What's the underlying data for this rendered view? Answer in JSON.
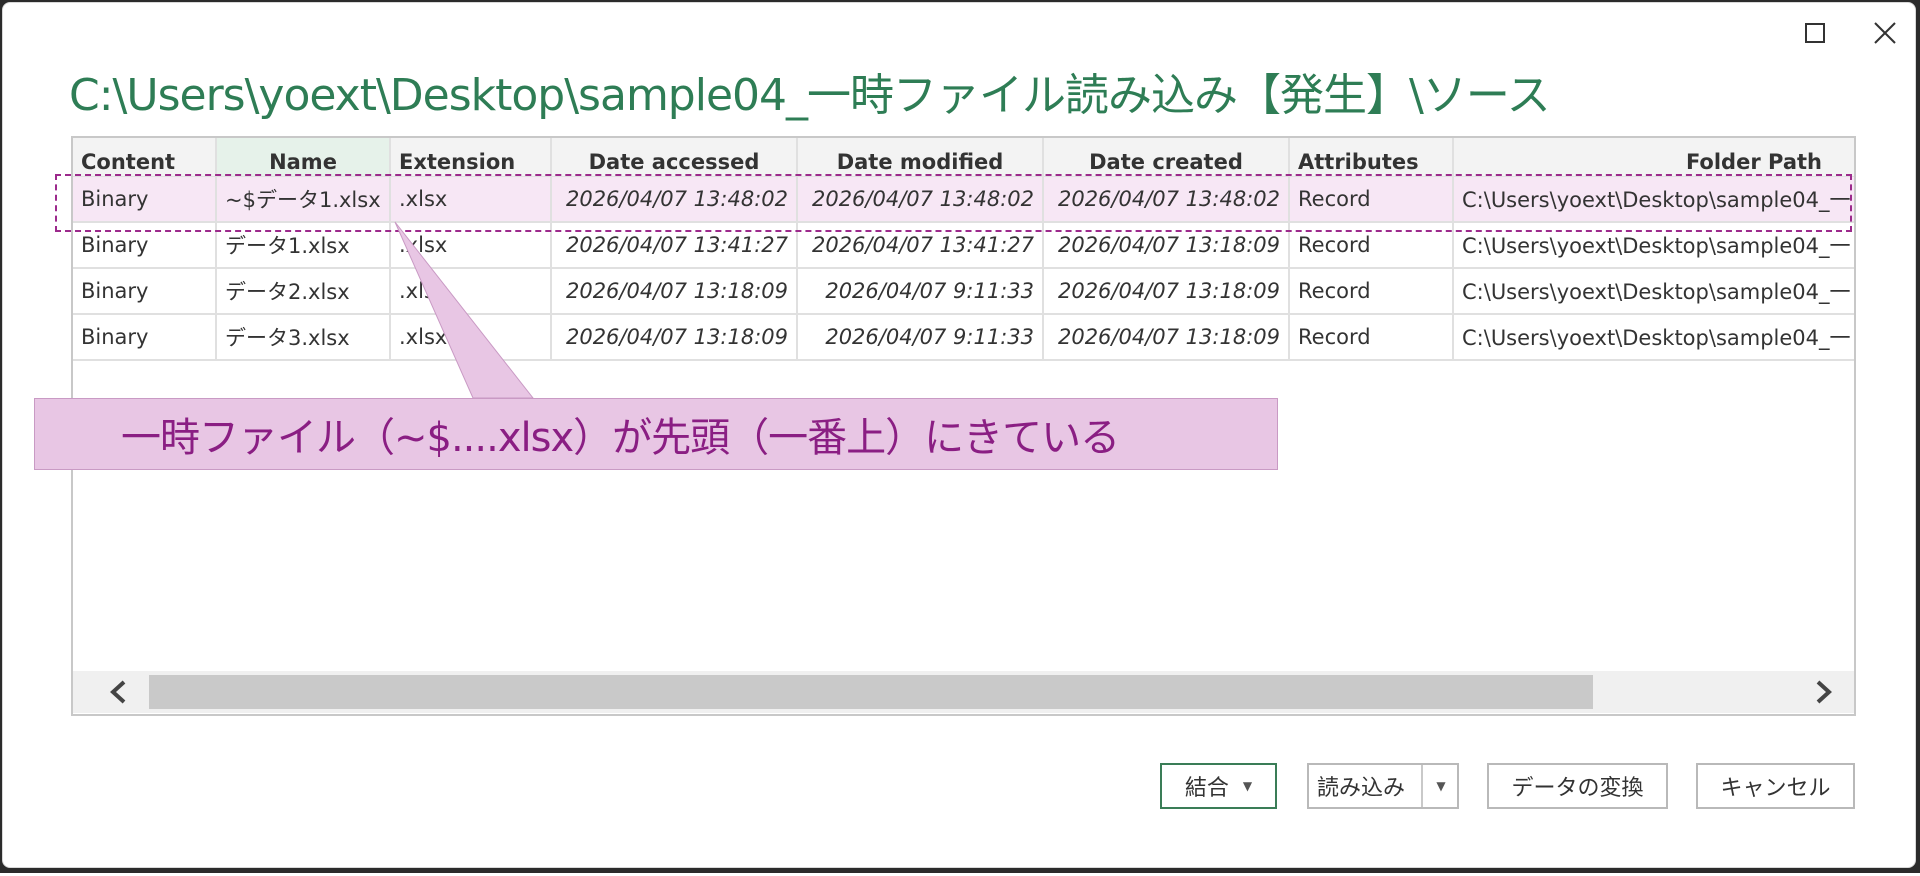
{
  "window": {
    "title": "C:\\Users\\yoext\\Desktop\\sample04_一時ファイル読み込み【発生】\\ソース"
  },
  "table": {
    "columns": [
      "Content",
      "Name",
      "Extension",
      "Date accessed",
      "Date modified",
      "Date created",
      "Attributes",
      "Folder Path"
    ],
    "rows": [
      [
        "Binary",
        "~$データ1.xlsx",
        ".xlsx",
        "2026/04/07 13:48:02",
        "2026/04/07 13:48:02",
        "2026/04/07 13:48:02",
        "Record",
        "C:\\Users\\yoext\\Desktop\\sample04_一"
      ],
      [
        "Binary",
        "データ1.xlsx",
        ".xlsx",
        "2026/04/07 13:41:27",
        "2026/04/07 13:41:27",
        "2026/04/07 13:18:09",
        "Record",
        "C:\\Users\\yoext\\Desktop\\sample04_一"
      ],
      [
        "Binary",
        "データ2.xlsx",
        ".xlsx",
        "2026/04/07 13:18:09",
        "2026/04/07 9:11:33",
        "2026/04/07 13:18:09",
        "Record",
        "C:\\Users\\yoext\\Desktop\\sample04_一"
      ],
      [
        "Binary",
        "データ3.xlsx",
        ".xlsx",
        "2026/04/07 13:18:09",
        "2026/04/07 9:11:33",
        "2026/04/07 13:18:09",
        "Record",
        "C:\\Users\\yoext\\Desktop\\sample04_一"
      ]
    ]
  },
  "annotation": {
    "text": "一時ファイル（~$....xlsx）が先頭（一番上）にきている"
  },
  "buttons": {
    "combine": "結合",
    "load": "読み込み",
    "transform": "データの変換",
    "cancel": "キャンセル"
  },
  "colors": {
    "title": "#2e7d55",
    "annotation_fill": "#e8c6e4",
    "annotation_text": "#8a1e83",
    "highlight_border": "#9c2a8c"
  },
  "icons": {
    "maximize": "maximize-icon",
    "close": "close-icon",
    "scroll_left": "chevron-left-icon",
    "scroll_right": "chevron-right-icon",
    "dropdown": "caret-down-icon"
  }
}
